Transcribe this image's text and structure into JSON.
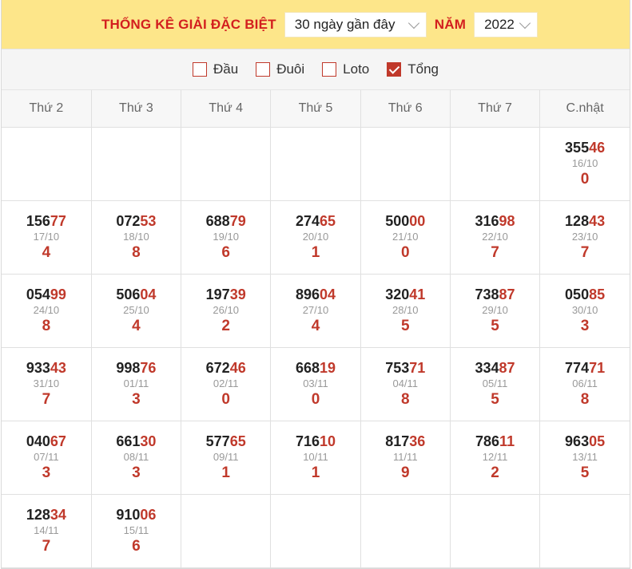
{
  "header": {
    "title": "THỐNG KÊ GIẢI ĐẶC BIỆT",
    "range_value": "30 ngày gần đây",
    "year_label": "NĂM",
    "year_value": "2022"
  },
  "filters": [
    {
      "label": "Đầu",
      "checked": false
    },
    {
      "label": "Đuôi",
      "checked": false
    },
    {
      "label": "Loto",
      "checked": false
    },
    {
      "label": "Tổng",
      "checked": true
    }
  ],
  "weekdays": [
    "Thứ 2",
    "Thứ 3",
    "Thứ 4",
    "Thứ 5",
    "Thứ 6",
    "Thứ 7",
    "C.nhật"
  ],
  "weeks": [
    [
      null,
      null,
      null,
      null,
      null,
      null,
      {
        "head": "355",
        "tail": "46",
        "date": "16/10",
        "sum": "0"
      }
    ],
    [
      {
        "head": "156",
        "tail": "77",
        "date": "17/10",
        "sum": "4"
      },
      {
        "head": "072",
        "tail": "53",
        "date": "18/10",
        "sum": "8"
      },
      {
        "head": "688",
        "tail": "79",
        "date": "19/10",
        "sum": "6"
      },
      {
        "head": "274",
        "tail": "65",
        "date": "20/10",
        "sum": "1"
      },
      {
        "head": "500",
        "tail": "00",
        "date": "21/10",
        "sum": "0"
      },
      {
        "head": "316",
        "tail": "98",
        "date": "22/10",
        "sum": "7"
      },
      {
        "head": "128",
        "tail": "43",
        "date": "23/10",
        "sum": "7"
      }
    ],
    [
      {
        "head": "054",
        "tail": "99",
        "date": "24/10",
        "sum": "8"
      },
      {
        "head": "506",
        "tail": "04",
        "date": "25/10",
        "sum": "4"
      },
      {
        "head": "197",
        "tail": "39",
        "date": "26/10",
        "sum": "2"
      },
      {
        "head": "896",
        "tail": "04",
        "date": "27/10",
        "sum": "4"
      },
      {
        "head": "320",
        "tail": "41",
        "date": "28/10",
        "sum": "5"
      },
      {
        "head": "738",
        "tail": "87",
        "date": "29/10",
        "sum": "5"
      },
      {
        "head": "050",
        "tail": "85",
        "date": "30/10",
        "sum": "3"
      }
    ],
    [
      {
        "head": "933",
        "tail": "43",
        "date": "31/10",
        "sum": "7"
      },
      {
        "head": "998",
        "tail": "76",
        "date": "01/11",
        "sum": "3"
      },
      {
        "head": "672",
        "tail": "46",
        "date": "02/11",
        "sum": "0"
      },
      {
        "head": "668",
        "tail": "19",
        "date": "03/11",
        "sum": "0"
      },
      {
        "head": "753",
        "tail": "71",
        "date": "04/11",
        "sum": "8"
      },
      {
        "head": "334",
        "tail": "87",
        "date": "05/11",
        "sum": "5"
      },
      {
        "head": "774",
        "tail": "71",
        "date": "06/11",
        "sum": "8"
      }
    ],
    [
      {
        "head": "040",
        "tail": "67",
        "date": "07/11",
        "sum": "3"
      },
      {
        "head": "661",
        "tail": "30",
        "date": "08/11",
        "sum": "3"
      },
      {
        "head": "577",
        "tail": "65",
        "date": "09/11",
        "sum": "1"
      },
      {
        "head": "716",
        "tail": "10",
        "date": "10/11",
        "sum": "1"
      },
      {
        "head": "817",
        "tail": "36",
        "date": "11/11",
        "sum": "9"
      },
      {
        "head": "786",
        "tail": "11",
        "date": "12/11",
        "sum": "2"
      },
      {
        "head": "963",
        "tail": "05",
        "date": "13/11",
        "sum": "5"
      }
    ],
    [
      {
        "head": "128",
        "tail": "34",
        "date": "14/11",
        "sum": "7"
      },
      {
        "head": "910",
        "tail": "06",
        "date": "15/11",
        "sum": "6"
      },
      null,
      null,
      null,
      null,
      null
    ]
  ]
}
